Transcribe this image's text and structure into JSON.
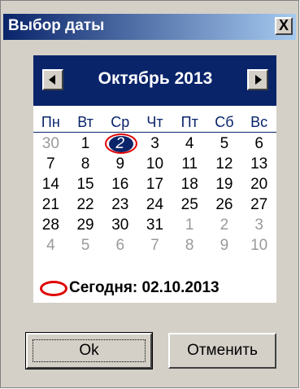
{
  "window": {
    "title": "Выбор даты",
    "close_label": "X"
  },
  "calendar": {
    "month_title": "Октябрь 2013",
    "weekdays": [
      "Пн",
      "Вт",
      "Ср",
      "Чт",
      "Пт",
      "Сб",
      "Вс"
    ],
    "days": [
      {
        "n": "30",
        "muted": true
      },
      {
        "n": "1"
      },
      {
        "n": "2",
        "selected": true
      },
      {
        "n": "3"
      },
      {
        "n": "4"
      },
      {
        "n": "5"
      },
      {
        "n": "6"
      },
      {
        "n": "7"
      },
      {
        "n": "8"
      },
      {
        "n": "9"
      },
      {
        "n": "10"
      },
      {
        "n": "11"
      },
      {
        "n": "12"
      },
      {
        "n": "13"
      },
      {
        "n": "14"
      },
      {
        "n": "15"
      },
      {
        "n": "16"
      },
      {
        "n": "17"
      },
      {
        "n": "18"
      },
      {
        "n": "19"
      },
      {
        "n": "20"
      },
      {
        "n": "21"
      },
      {
        "n": "22"
      },
      {
        "n": "23"
      },
      {
        "n": "24"
      },
      {
        "n": "25"
      },
      {
        "n": "26"
      },
      {
        "n": "27"
      },
      {
        "n": "28"
      },
      {
        "n": "29"
      },
      {
        "n": "30"
      },
      {
        "n": "31"
      },
      {
        "n": "1",
        "muted": true
      },
      {
        "n": "2",
        "muted": true
      },
      {
        "n": "3",
        "muted": true
      },
      {
        "n": "4",
        "muted": true
      },
      {
        "n": "5",
        "muted": true
      },
      {
        "n": "6",
        "muted": true
      },
      {
        "n": "7",
        "muted": true
      },
      {
        "n": "8",
        "muted": true
      },
      {
        "n": "9",
        "muted": true
      },
      {
        "n": "10",
        "muted": true
      }
    ],
    "today_label": "Сегодня: 02.10.2013"
  },
  "buttons": {
    "ok_label": "Ok",
    "cancel_label": "Отменить"
  },
  "colors": {
    "header_bg": "#0a246a",
    "highlight": "#e00000",
    "face": "#d4d0c8"
  },
  "icons": {
    "prev": "triangle-left-icon",
    "next": "triangle-right-icon"
  }
}
